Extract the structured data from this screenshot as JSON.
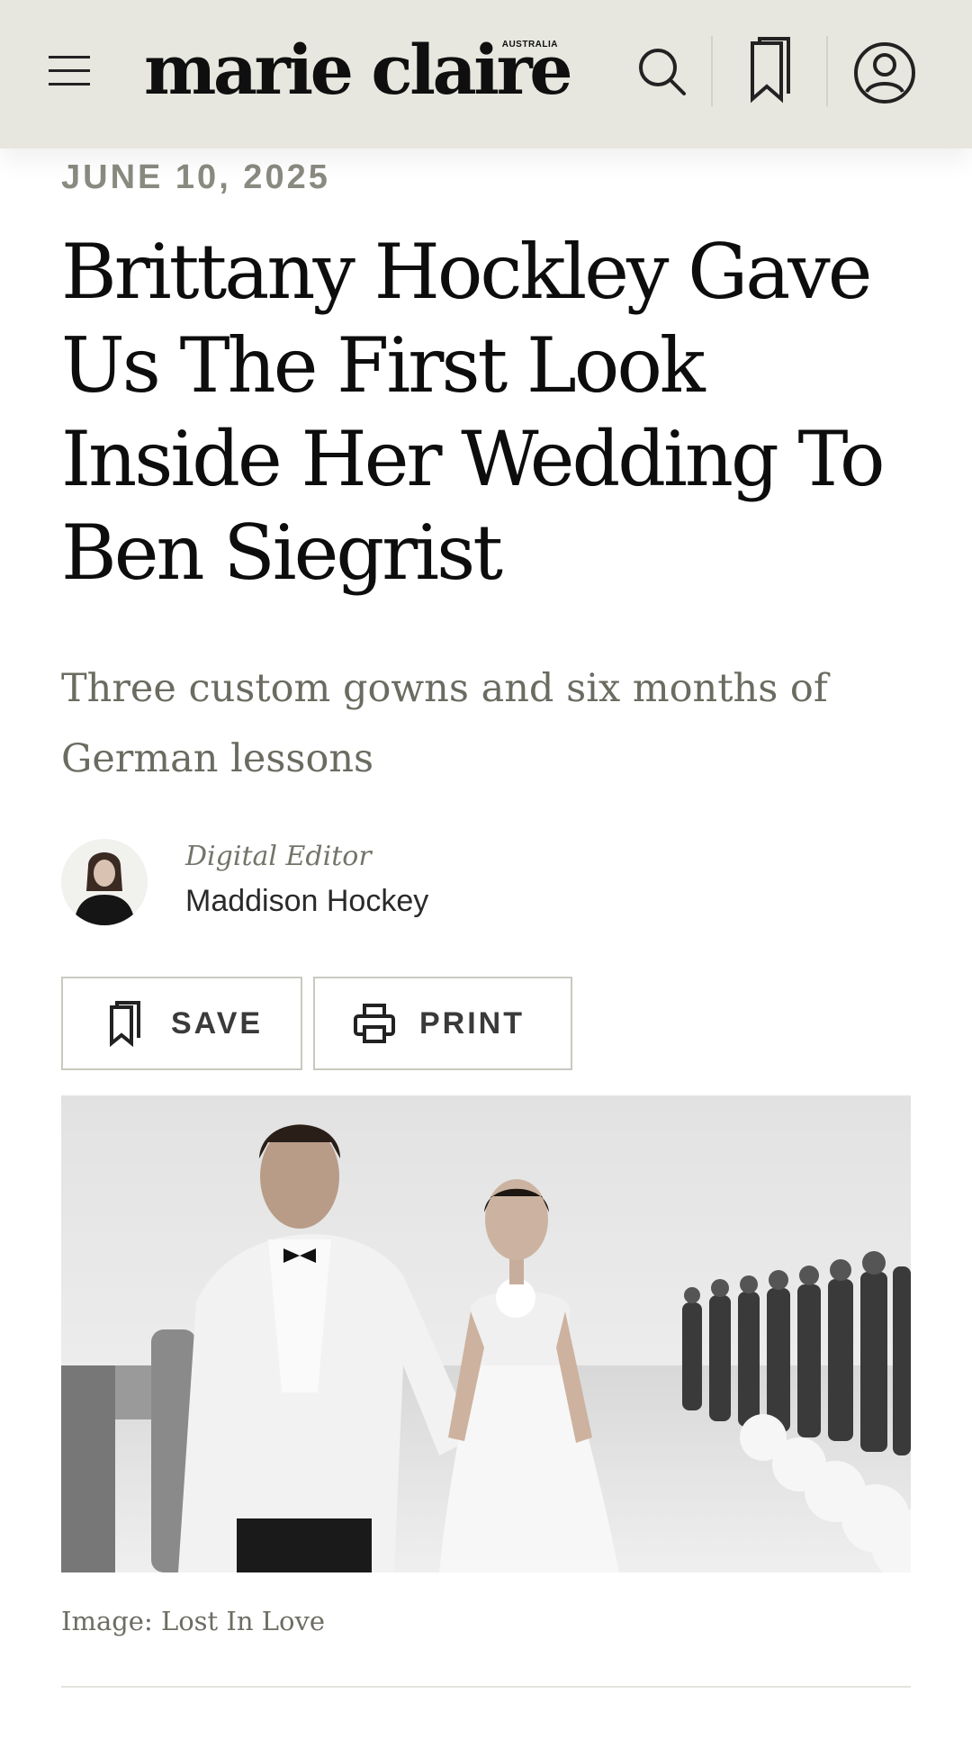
{
  "header": {
    "logo_text": "marie claire",
    "logo_sub": "AUSTRALIA",
    "icons": [
      "menu-icon",
      "search-icon",
      "bookmark-icon",
      "account-icon"
    ]
  },
  "article": {
    "date": "JUNE 10, 2025",
    "headline": "Brittany Hockley Gave Us The First Look Inside Her Wedding To Ben Siegrist",
    "subtitle": "Three custom gowns and six months of German lessons",
    "author": {
      "role": "Digital Editor",
      "name": "Maddison Hockey"
    },
    "actions": {
      "save_label": "SAVE",
      "print_label": "PRINT"
    },
    "image_caption": "Image: Lost In Love"
  },
  "colors": {
    "header_bg": "#e7e7df",
    "date_text": "#8a8a80",
    "subtitle_text": "#6b6b61",
    "button_border": "#c9c9c1"
  }
}
